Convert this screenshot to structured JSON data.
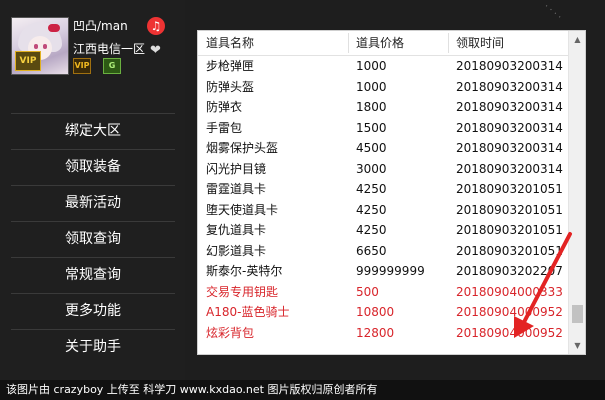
{
  "profile": {
    "username": "凹凸/man",
    "server": "江西电信一区",
    "vip_badge": "VIP",
    "badge_vip": "VIP",
    "badge_green": "G",
    "music_icon": "music-note-icon",
    "heart_icon": "diamond-heart-icon"
  },
  "menu": {
    "items": [
      {
        "label": "绑定大区"
      },
      {
        "label": "领取装备"
      },
      {
        "label": "最新活动"
      },
      {
        "label": "领取查询"
      },
      {
        "label": "常规查询"
      },
      {
        "label": "更多功能"
      },
      {
        "label": "关于助手"
      }
    ]
  },
  "table": {
    "headers": [
      "道具名称",
      "道具价格",
      "领取时间"
    ],
    "rows": [
      {
        "name": "步枪弹匣",
        "price": "1000",
        "time": "20180903200314",
        "highlight": false
      },
      {
        "name": "防弹头盔",
        "price": "1000",
        "time": "20180903200314",
        "highlight": false
      },
      {
        "name": "防弹衣",
        "price": "1800",
        "time": "20180903200314",
        "highlight": false
      },
      {
        "name": "手雷包",
        "price": "1500",
        "time": "20180903200314",
        "highlight": false
      },
      {
        "name": "烟雾保护头盔",
        "price": "4500",
        "time": "20180903200314",
        "highlight": false
      },
      {
        "name": "闪光护目镜",
        "price": "3000",
        "time": "20180903200314",
        "highlight": false
      },
      {
        "name": "雷霆道具卡",
        "price": "4250",
        "time": "20180903201051",
        "highlight": false
      },
      {
        "name": "堕天使道具卡",
        "price": "4250",
        "time": "20180903201051",
        "highlight": false
      },
      {
        "name": "复仇道具卡",
        "price": "4250",
        "time": "20180903201051",
        "highlight": false
      },
      {
        "name": "幻影道具卡",
        "price": "6650",
        "time": "20180903201051",
        "highlight": false
      },
      {
        "name": "斯泰尔-英特尔",
        "price": "999999999",
        "time": "20180903202207",
        "highlight": false
      },
      {
        "name": "交易专用钥匙",
        "price": "500",
        "time": "20180904000333",
        "highlight": true
      },
      {
        "name": "A180-蓝色骑士",
        "price": "10800",
        "time": "20180904000952",
        "highlight": true
      },
      {
        "name": "炫彩背包",
        "price": "12800",
        "time": "20180904000952",
        "highlight": true
      }
    ],
    "scroll_position": 0.95,
    "highlight_color": "#d8252b"
  },
  "footer": {
    "text": "该图片由 crazyboy 上传至 科学刀 www.kxdao.net 图片版权归原创者所有"
  }
}
